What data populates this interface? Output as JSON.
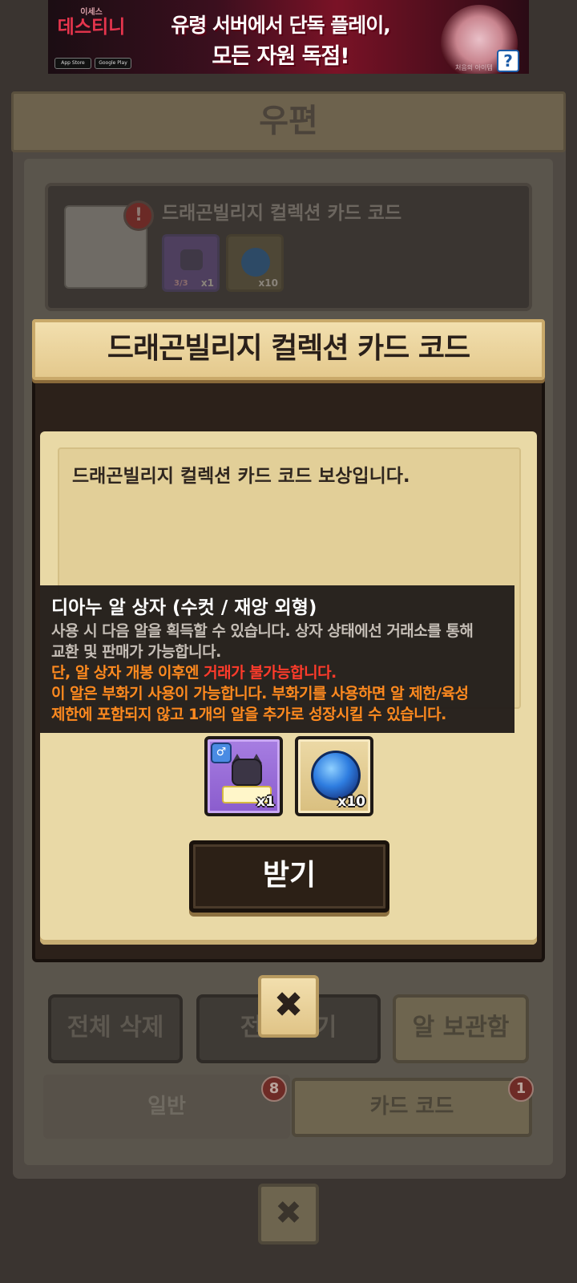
{
  "ad": {
    "logo_small": "이세스",
    "logo": "데스티니",
    "headline_1": "유령 서버에서 단독 플레이,",
    "headline_2": "모든 자원 독점!",
    "store_1": "App Store",
    "store_2": "Google Play",
    "help_icon": "?",
    "tiny_text": "처음의 아이템"
  },
  "mailbox": {
    "title": "우편",
    "mail_item": {
      "subject": "드래곤빌리지 컬렉션 카드 코드",
      "warning_icon": "!",
      "reward_1_fraction": "3/3",
      "reward_1_count": "x1",
      "reward_2_count": "x10"
    },
    "buttons": {
      "delete_all": "전체 삭제",
      "receive_all": "전체 받기",
      "egg_storage": "알 보관함"
    },
    "tabs": {
      "general": "일반",
      "general_count": "8",
      "card_code": "카드 코드",
      "card_code_count": "1"
    },
    "close_icon": "✖"
  },
  "popup": {
    "title": "드래곤빌리지 컬렉션 카드 코드",
    "message": "드래곤빌리지 컬렉션 카드 코드 보상입니다.",
    "rewards": [
      {
        "name": "디아누 알 상자 (수컷 / 재앙 외형)",
        "count": "x1",
        "icon": "egg-box-icon"
      },
      {
        "name": "부화기",
        "count": "x10",
        "icon": "incubator-orb-icon"
      }
    ],
    "receive_label": "받기",
    "close_icon": "✖"
  },
  "tooltip": {
    "title": "디아누 알 상자 (수컷 / 재앙 외형)",
    "line_1": "사용 시 다음 알을 획득할 수 있습니다. 상자 상태에선 거래소를 통해",
    "line_2": "교환 및 판매가 가능합니다.",
    "line_3_orange": "단, 알 상자 개봉 이후엔 ",
    "line_3_red": "거래가 불가능합니다.",
    "line_4": "이 알은 부화기 사용이 가능합니다. 부화기를 사용하면 알 제한/육성",
    "line_5": "제한에 포함되지 않고 1개의 알을 추가로 성장시킬 수 있습니다."
  },
  "colors": {
    "popup_title_bg": "#f2dfae",
    "popup_body_bg": "#e9d9a6",
    "receive_button_bg": "#2c2016",
    "tooltip_orange": "#ff8a1f",
    "tooltip_red": "#ff3b2b"
  }
}
